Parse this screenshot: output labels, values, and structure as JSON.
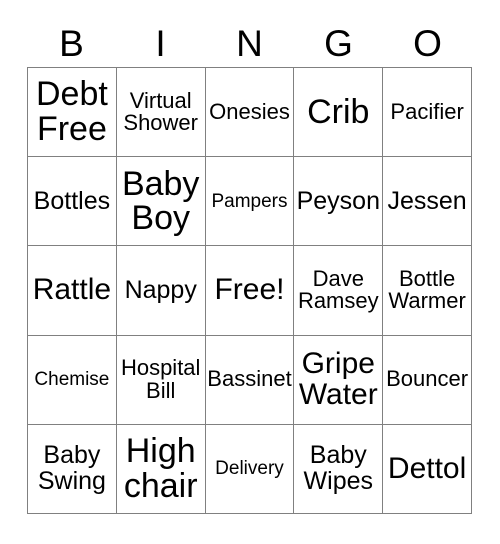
{
  "header": {
    "letters": [
      "B",
      "I",
      "N",
      "G",
      "O"
    ]
  },
  "colors": {
    "border": "#808080",
    "cell_background": "#ffffff",
    "text": "#000000",
    "page_background": "#ffffff"
  },
  "grid": {
    "rows": 5,
    "columns": 5,
    "cells": [
      {
        "text": "Debt\nFree",
        "size": "xxl"
      },
      {
        "text": "Virtual\nShower",
        "size": "md"
      },
      {
        "text": "Onesies",
        "size": "md"
      },
      {
        "text": "Crib",
        "size": "xxl"
      },
      {
        "text": "Pacifier",
        "size": "md"
      },
      {
        "text": "Bottles",
        "size": "lg"
      },
      {
        "text": "Baby\nBoy",
        "size": "xxl"
      },
      {
        "text": "Pampers",
        "size": "sm"
      },
      {
        "text": "Peyson",
        "size": "lg"
      },
      {
        "text": "Jessen",
        "size": "lg"
      },
      {
        "text": "Rattle",
        "size": "xl"
      },
      {
        "text": "Nappy",
        "size": "lg"
      },
      {
        "text": "Free!",
        "size": "xl"
      },
      {
        "text": "Dave\nRamsey",
        "size": "md"
      },
      {
        "text": "Bottle\nWarmer",
        "size": "md"
      },
      {
        "text": "Chemise",
        "size": "sm"
      },
      {
        "text": "Hospital\nBill",
        "size": "md"
      },
      {
        "text": "Bassinet",
        "size": "md"
      },
      {
        "text": "Gripe\nWater",
        "size": "xl"
      },
      {
        "text": "Bouncer",
        "size": "md"
      },
      {
        "text": "Baby\nSwing",
        "size": "lg"
      },
      {
        "text": "High\nchair",
        "size": "xxl"
      },
      {
        "text": "Delivery",
        "size": "sm"
      },
      {
        "text": "Baby\nWipes",
        "size": "lg"
      },
      {
        "text": "Dettol",
        "size": "xl"
      }
    ]
  }
}
